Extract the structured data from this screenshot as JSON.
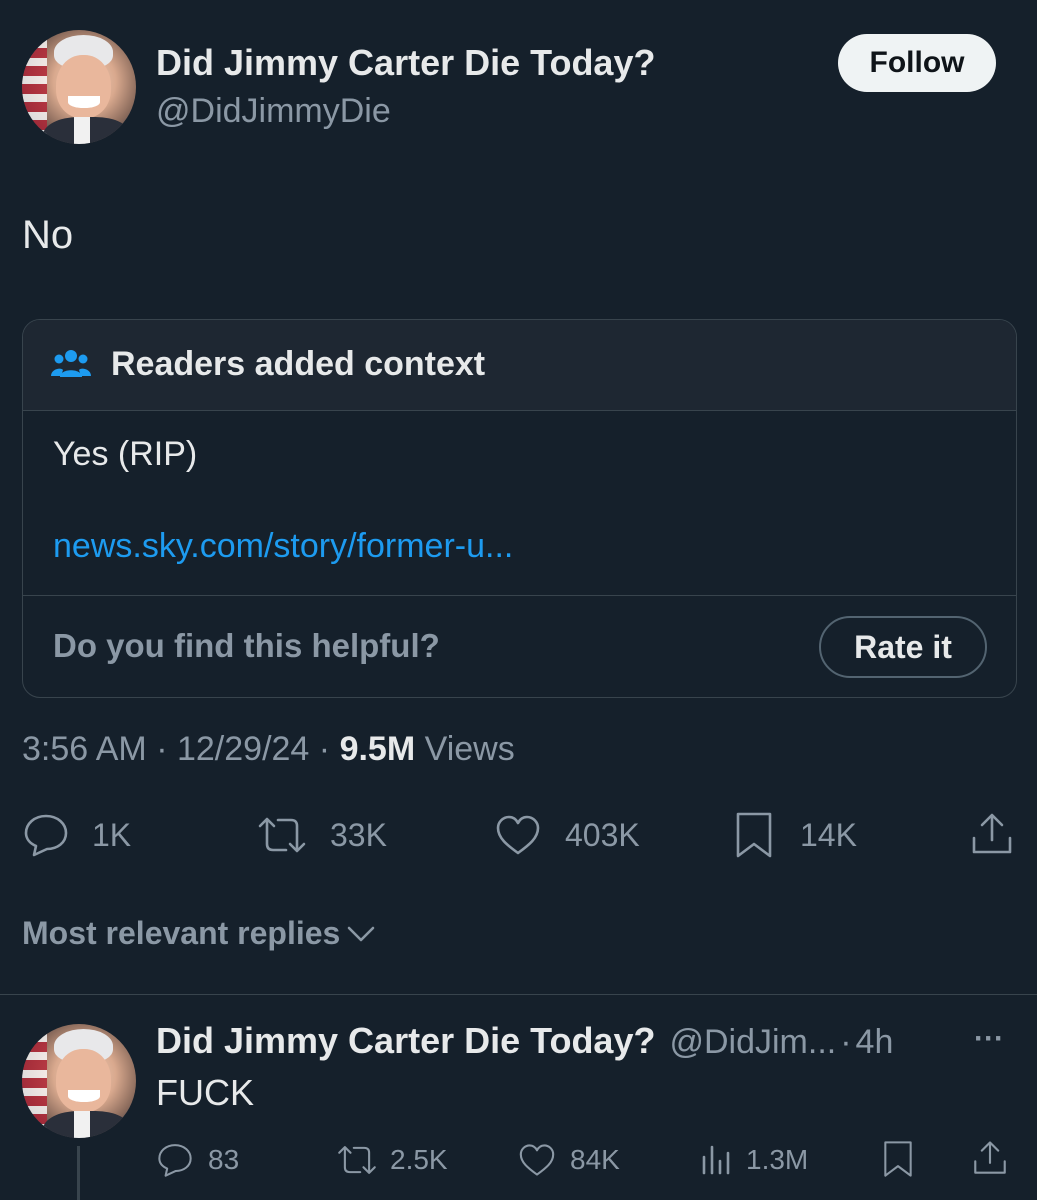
{
  "tweet": {
    "author_name": "Did Jimmy Carter Die Today?",
    "author_handle": "@DidJimmyDie",
    "follow_label": "Follow",
    "text": "No",
    "note": {
      "title": "Readers added context",
      "body": "Yes (RIP)",
      "link": "news.sky.com/story/former-u...",
      "helpful_question": "Do you find this helpful?",
      "rate_label": "Rate it"
    },
    "time": "3:56 AM",
    "date": "12/29/24",
    "views_count": "9.5M",
    "views_label": "Views",
    "sep": "·",
    "stats": {
      "replies": "1K",
      "retweets": "33K",
      "likes": "403K",
      "bookmarks": "14K"
    }
  },
  "replies_sort_label": "Most relevant replies",
  "reply": {
    "author_name": "Did Jimmy Carter Die Today?",
    "author_handle": "@DidJim...",
    "time": "4h",
    "sep": "·",
    "text": "FUCK",
    "more": "···",
    "stats": {
      "replies": "83",
      "retweets": "2.5K",
      "likes": "84K",
      "views": "1.3M"
    }
  },
  "colors": {
    "background": "#15202b",
    "text": "#e7e9ea",
    "muted": "#8b98a5",
    "link": "#1d9bf0",
    "border": "#38444d"
  },
  "icons": [
    "people-icon",
    "reply-icon",
    "retweet-icon",
    "like-icon",
    "bookmark-icon",
    "share-icon",
    "views-icon",
    "chevron-down-icon",
    "more-icon"
  ]
}
